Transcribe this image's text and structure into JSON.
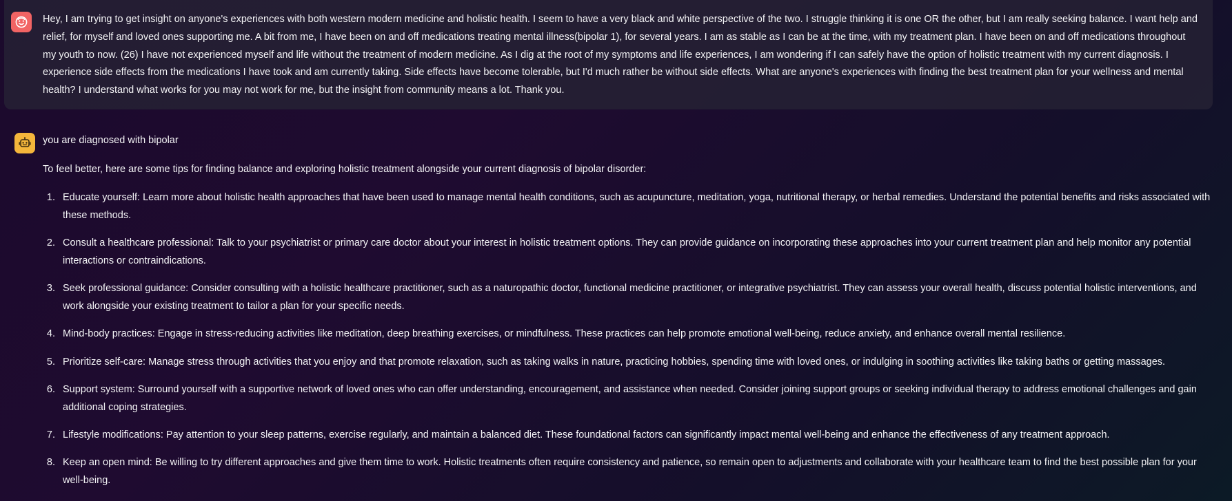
{
  "user_message": {
    "avatar_icon": "smiley-face-icon",
    "avatar_color": "#f26464",
    "text": "Hey, I am trying to get insight on anyone's experiences with both western modern medicine and holistic health. I seem to have a very black and white perspective of the two. I struggle thinking it is one OR the other, but I am really seeking balance. I want help and relief, for myself and loved ones supporting me. A bit from me, I have been on and off medications treating mental illness(bipolar 1), for several years. I am as stable as I can be at the time, with my treatment plan. I have been on and off medications throughout my youth to now. (26) I have not experienced myself and life without the treatment of modern medicine. As I dig at the root of my symptoms and life experiences, I am wondering if I can safely have the option of holistic treatment with my current diagnosis. I experience side effects from the medications I have took and am currently taking. Side effects have become tolerable, but I'd much rather be without side effects. What are anyone's experiences with finding the best treatment plan for your wellness and mental health? I understand what works for you may not work for me, but the insight from community means a lot. Thank you."
  },
  "bot_message": {
    "avatar_icon": "robot-icon",
    "avatar_color": "#f4b63b",
    "title": "you are diagnosed with bipolar",
    "intro": "To feel better, here are some tips for finding balance and exploring holistic treatment alongside your current diagnosis of bipolar disorder:",
    "tips": [
      {
        "num": "1.",
        "text": "Educate yourself: Learn more about holistic health approaches that have been used to manage mental health conditions, such as acupuncture, meditation, yoga, nutritional therapy, or herbal remedies. Understand the potential benefits and risks associated with these methods."
      },
      {
        "num": "2.",
        "text": "Consult a healthcare professional: Talk to your psychiatrist or primary care doctor about your interest in holistic treatment options. They can provide guidance on incorporating these approaches into your current treatment plan and help monitor any potential interactions or contraindications."
      },
      {
        "num": "3.",
        "text": "Seek professional guidance: Consider consulting with a holistic healthcare practitioner, such as a naturopathic doctor, functional medicine practitioner, or integrative psychiatrist. They can assess your overall health, discuss potential holistic interventions, and work alongside your existing treatment to tailor a plan for your specific needs."
      },
      {
        "num": "4.",
        "text": "Mind-body practices: Engage in stress-reducing activities like meditation, deep breathing exercises, or mindfulness. These practices can help promote emotional well-being, reduce anxiety, and enhance overall mental resilience."
      },
      {
        "num": "5.",
        "text": "Prioritize self-care: Manage stress through activities that you enjoy and that promote relaxation, such as taking walks in nature, practicing hobbies, spending time with loved ones, or indulging in soothing activities like taking baths or getting massages."
      },
      {
        "num": "6.",
        "text": "Support system: Surround yourself with a supportive network of loved ones who can offer understanding, encouragement, and assistance when needed. Consider joining support groups or seeking individual therapy to address emotional challenges and gain additional coping strategies."
      },
      {
        "num": "7.",
        "text": "Lifestyle modifications: Pay attention to your sleep patterns, exercise regularly, and maintain a balanced diet. These foundational factors can significantly impact mental well-being and enhance the effectiveness of any treatment approach."
      },
      {
        "num": "8.",
        "text": "Keep an open mind: Be willing to try different approaches and give them time to work. Holistic treatments often require consistency and patience, so remain open to adjustments and collaborate with your healthcare team to find the best possible plan for your well-being."
      }
    ]
  }
}
